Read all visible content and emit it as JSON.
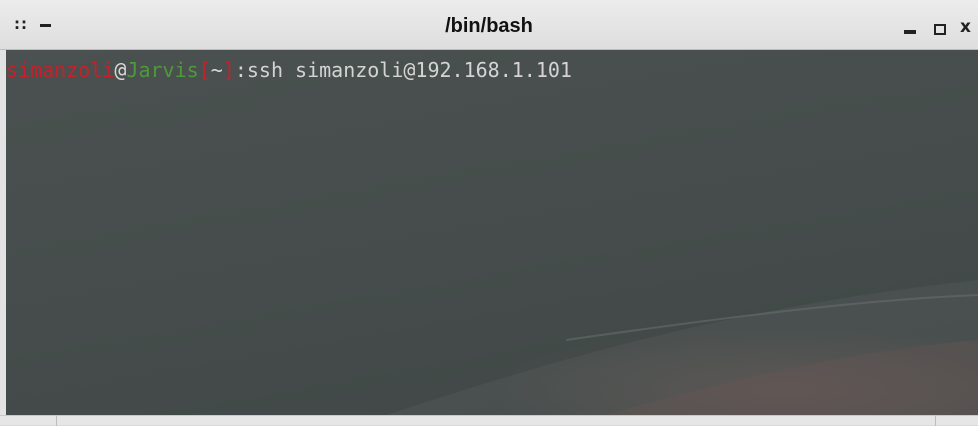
{
  "window": {
    "title": "/bin/bash",
    "menu_glyph": "::",
    "close_glyph": "x"
  },
  "terminal": {
    "prompt_user": "simanzoli",
    "prompt_at": "@",
    "prompt_host": "Jarvis",
    "prompt_open": "[",
    "prompt_dir": "~",
    "prompt_close": "]",
    "prompt_sep": ":",
    "command": "ssh simanzoli@192.168.1.101"
  },
  "colors": {
    "user": "#c8202a",
    "host": "#4e9a3a",
    "text": "#d4d4d4",
    "terminal_bg": "#4a5150"
  },
  "icons": {
    "menu": "window-menu-icon",
    "shade": "shade-icon",
    "minimize": "minimize-icon",
    "maximize": "maximize-icon",
    "close": "close-icon"
  }
}
